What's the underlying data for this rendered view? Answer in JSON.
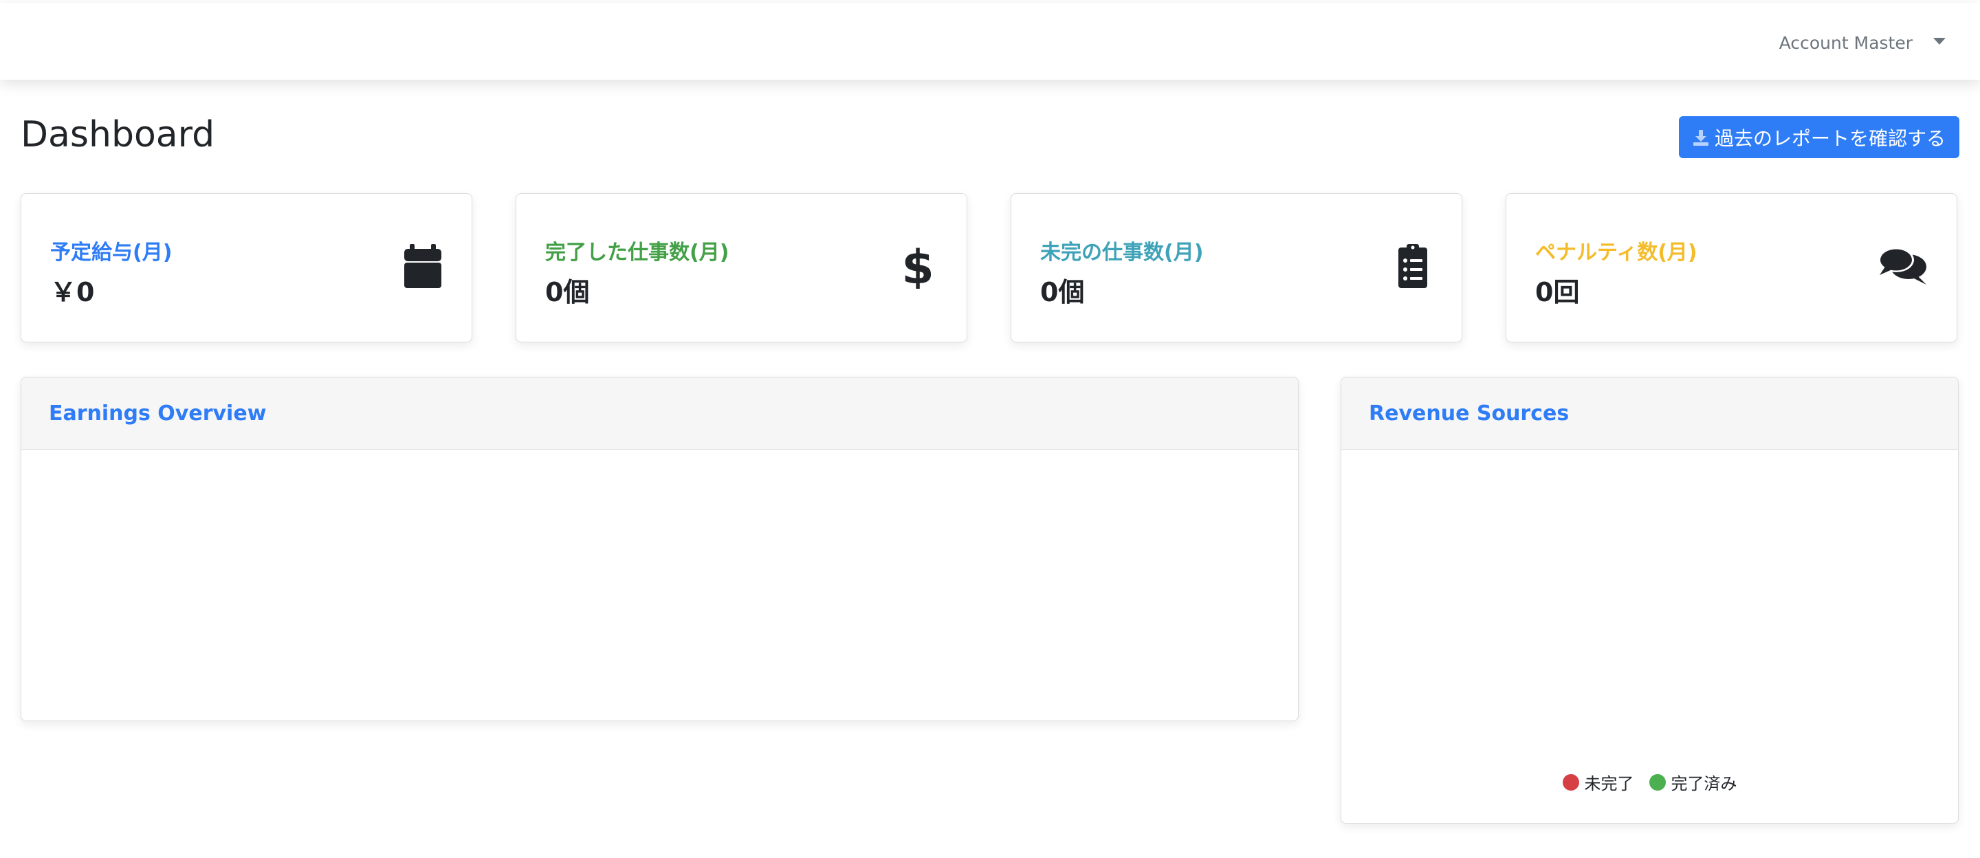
{
  "header": {
    "account_name": "Account Master"
  },
  "page": {
    "title": "Dashboard",
    "report_button": "過去のレポートを確認する"
  },
  "stats": [
    {
      "label": "予定給与(月)",
      "value": "￥0",
      "color": "#2e7cf6",
      "icon": "calendar-icon"
    },
    {
      "label": "完了した仕事数(月)",
      "value": "0個",
      "color": "#43a047",
      "icon": "dollar-icon"
    },
    {
      "label": "未完の仕事数(月)",
      "value": "0個",
      "color": "#3ea2b8",
      "icon": "clipboard-list-icon"
    },
    {
      "label": "ペナルティ数(月)",
      "value": "0回",
      "color": "#f4bc2a",
      "icon": "comments-icon"
    }
  ],
  "earnings": {
    "title": "Earnings Overview"
  },
  "revenue": {
    "title": "Revenue Sources",
    "legend": [
      {
        "label": "未完了",
        "color": "#d64045"
      },
      {
        "label": "完了済み",
        "color": "#4caf50"
      }
    ]
  }
}
